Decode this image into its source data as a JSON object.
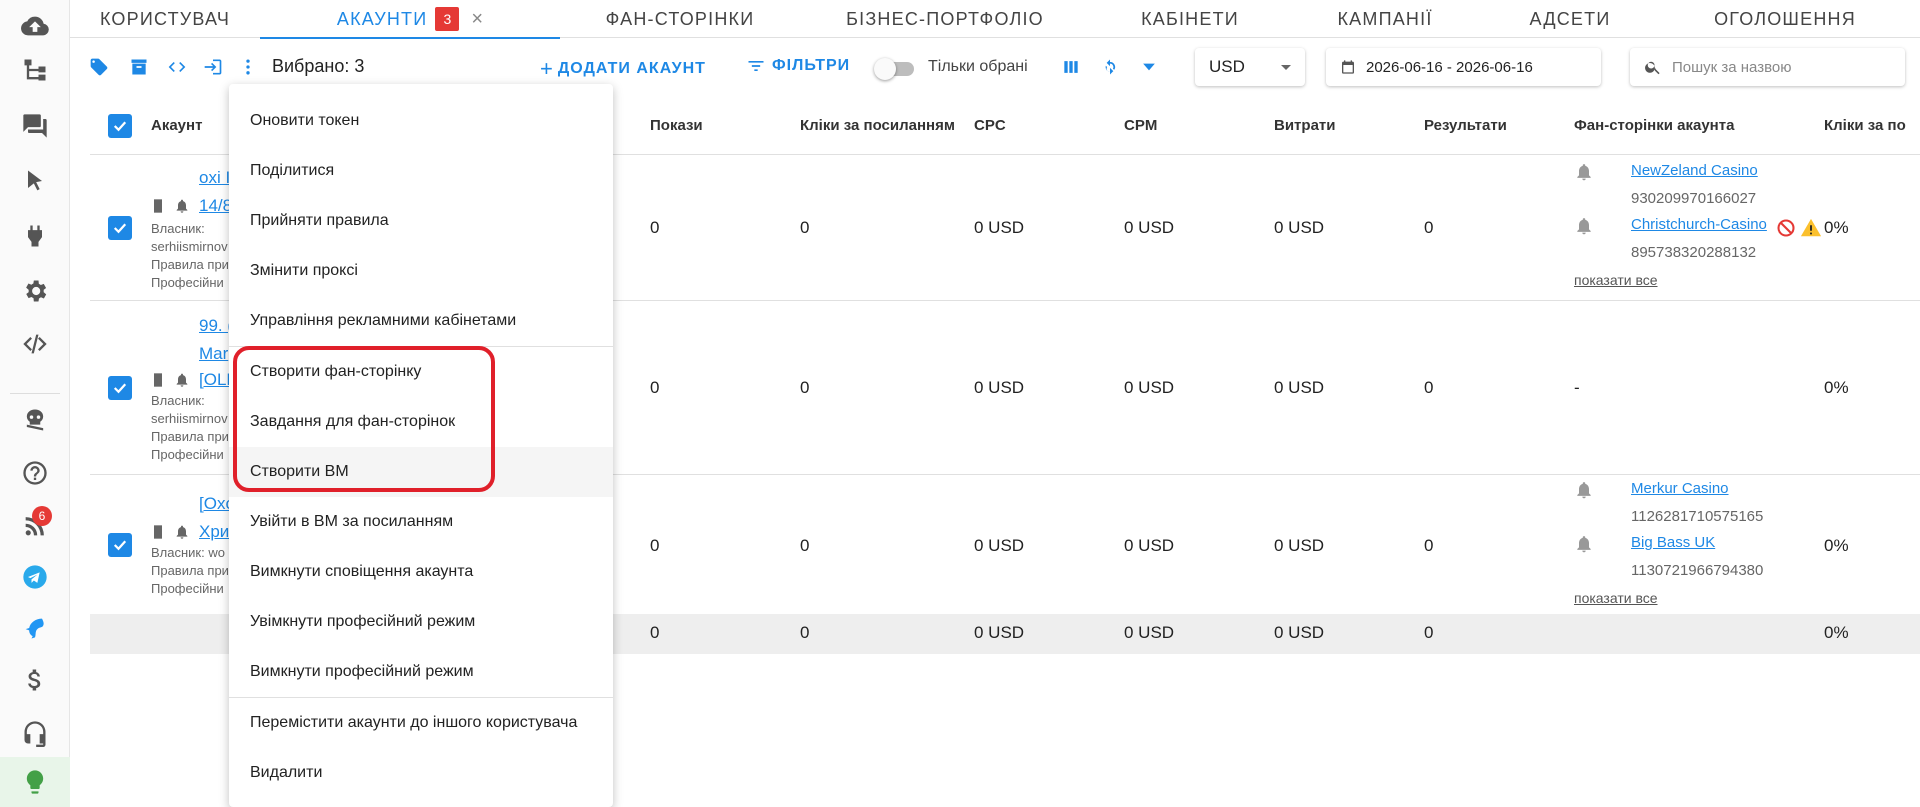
{
  "tabs": [
    {
      "label": "КОРИСТУВАЧ"
    },
    {
      "label": "АКАУНТИ",
      "badge": "3"
    },
    {
      "label": "ФАН-СТОРІНКИ"
    },
    {
      "label": "БІЗНЕС-ПОРТФОЛІО"
    },
    {
      "label": "КАБІНЕТИ"
    },
    {
      "label": "КАМПАНІЇ"
    },
    {
      "label": "АДСЕТИ"
    },
    {
      "label": "ОГОЛОШЕННЯ"
    }
  ],
  "tab_close": "×",
  "toolbar": {
    "selected": "Вибрано: 3",
    "add_account": "ДОДАТИ АКАУНТ",
    "filters": "ФІЛЬТРИ",
    "only_selected": "Тільки обрані",
    "currency": "USD",
    "date_range": "2026-06-16 - 2026-06-16",
    "search_placeholder": "Пошук за назвою"
  },
  "table": {
    "headers": [
      "Акаунт",
      "Покази",
      "Кліки за посиланням",
      "CPC",
      "CPM",
      "Витрати",
      "Результати",
      "Фан-сторінки акаунта",
      "Кліки за по"
    ],
    "rows": [
      {
        "name_lines": [
          "oxi I",
          "14/8"
        ],
        "owner_label": "Власник:",
        "owner": "serhiismirnov",
        "rules": "Правила при",
        "prof": "Професійни",
        "shows": "0",
        "clicks": "0",
        "cpc": "0 USD",
        "cpm": "0 USD",
        "spend": "0 USD",
        "results": "0",
        "fanpages": [
          {
            "name": "NewZeland Casino",
            "id": "930209970166027"
          },
          {
            "name": "Christchurch-Casino",
            "id": "895738320288132"
          }
        ],
        "show_all": "показати все",
        "ctr": "0%"
      },
      {
        "name_lines": [
          "99. (",
          "Mar",
          "[OLD"
        ],
        "owner_label": "Власник:",
        "owner": "serhiismirnov",
        "rules": "Правила при",
        "prof": "Професійни",
        "shows": "0",
        "clicks": "0",
        "cpc": "0 USD",
        "cpm": "0 USD",
        "spend": "0 USD",
        "results": "0",
        "fanpages_empty": "-",
        "ctr": "0%"
      },
      {
        "name_lines": [
          "[Oxo",
          "Хри"
        ],
        "owner_label": "Власник: wo",
        "rules": "Правила при",
        "prof": "Професійни",
        "shows": "0",
        "clicks": "0",
        "cpc": "0 USD",
        "cpm": "0 USD",
        "spend": "0 USD",
        "results": "0",
        "fanpages": [
          {
            "name": "Merkur Casino",
            "id": "1126281710575165"
          },
          {
            "name": "Big Bass UK",
            "id": "1130721966794380"
          }
        ],
        "show_all": "показати все",
        "ctr": "0%"
      }
    ],
    "totals": {
      "shows": "0",
      "clicks": "0",
      "cpc": "0 USD",
      "cpm": "0 USD",
      "spend": "0 USD",
      "results": "0",
      "ctr": "0%"
    }
  },
  "menu": {
    "items": [
      "Оновити токен",
      "Поділитися",
      "Прийняти правила",
      "Змінити проксі",
      "Управління рекламними кабінетами",
      "Створити фан-сторінку",
      "Завдання для фан-сторінок",
      "Створити ВМ",
      "Увійти в ВМ за посиланням",
      "Вимкнути сповіщення акаунта",
      "Увімкнути професійний режим",
      "Вимкнути професійний режим",
      "Перемістити акаунти до іншого користувача",
      "Видалити"
    ]
  },
  "rail": {
    "icons": [
      "cloud-upload-icon",
      "sitemap-icon",
      "chat-icon",
      "cursor-icon",
      "plug-icon",
      "gear-icon",
      "code-icon",
      "pirate-logo-icon",
      "help-icon",
      "rss-icon",
      "telegram-icon",
      "dolphin-icon",
      "dollar-icon",
      "headset-icon",
      "lightbulb-icon"
    ],
    "rss_badge": "6"
  },
  "colors": {
    "accent": "#1e88e5",
    "danger": "#e53935",
    "highlight": "#e0202a"
  }
}
